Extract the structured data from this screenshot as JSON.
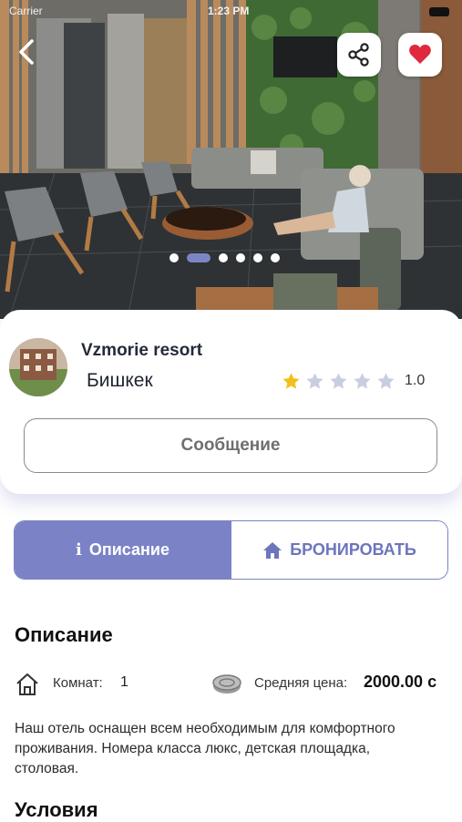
{
  "status_bar": {
    "carrier": "Carrier",
    "time": "1:23 PM"
  },
  "icons": {
    "back": "chevron-left-icon",
    "share": "share-icon",
    "favorite": "heart-icon",
    "rooms": "house-icon",
    "price": "coins-icon",
    "book": "home-icon",
    "info": "info-icon"
  },
  "colors": {
    "accent": "#7b83c6",
    "favorite": "#e0283e",
    "star_filled": "#f2c018",
    "star_empty": "#c9cde0"
  },
  "gallery": {
    "image_count": 6,
    "active_index": 1
  },
  "hotel": {
    "name": "Vzmorie resort",
    "city": "Бишкек",
    "rating_text": "1.0",
    "rating_value": 1,
    "rating_max": 5
  },
  "message_button": "Сообщение",
  "tabs": [
    {
      "label": "Описание",
      "glyph": "i",
      "active": true
    },
    {
      "label": "БРОНИРОВАТЬ",
      "active": false
    }
  ],
  "description": {
    "title": "Описание",
    "rooms_label": "Комнат:",
    "rooms_value": "1",
    "price_label": "Средняя цена:",
    "price_value": "2000.00 с",
    "text": "Наш отель оснащен всем необходимым для комфортного проживания. Номера класса люкс, детская площадка, столовая."
  },
  "conditions": {
    "title": "Условия"
  }
}
